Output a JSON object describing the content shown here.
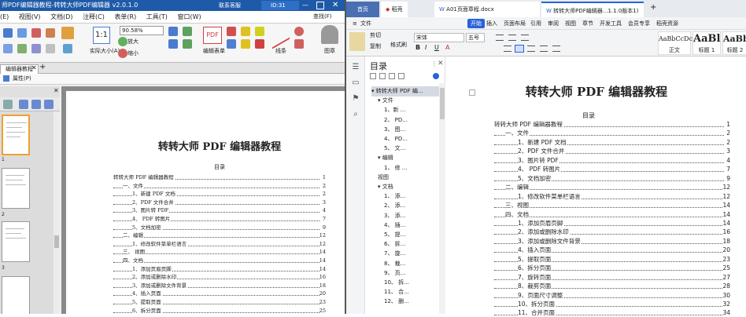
{
  "left_app": {
    "title": "师PDF编辑器教程-转转大师PDF编辑器 v2.0.1.0",
    "user": "联系客服",
    "id_badge": "ID:31",
    "menu": [
      "(E)",
      "视图(V)",
      "文档(D)",
      "注释(C)",
      "表单(R)",
      "工具(T)",
      "窗口(W)"
    ],
    "search": "查找(F)",
    "zoom": "90.58%",
    "ribbon": {
      "actual_size": "实际大小(A)",
      "zoom_in": "放大",
      "zoom_out": "缩小",
      "edit_form": "编辑表单",
      "line": "线条",
      "image": "图章"
    },
    "doc_tab": "编辑器教程",
    "sub_attr": "属性(P)",
    "page_labels": [
      "1",
      "2",
      "3"
    ],
    "doc_title": "转转大师 PDF 编辑器教程",
    "toc_title": "目录",
    "toc": [
      {
        "t": "转转大师 PDF 编辑器教程",
        "p": "1"
      },
      {
        "t": "一、文件",
        "p": "2"
      },
      {
        "t": "1、新建 PDF 文档",
        "p": "2"
      },
      {
        "t": "2、PDF 文件合并",
        "p": "3"
      },
      {
        "t": "3、图片转 PDF",
        "p": "4"
      },
      {
        "t": "4、 PDF 转图片",
        "p": "7"
      },
      {
        "t": "5、文档加密",
        "p": "9"
      },
      {
        "t": "二、编辑",
        "p": "12"
      },
      {
        "t": "1、修改软件菜单栏语言",
        "p": "12"
      },
      {
        "t": "三、 视图",
        "p": "14"
      },
      {
        "t": "四、文档",
        "p": "14"
      },
      {
        "t": "1、添加页眉页脚",
        "p": "14"
      },
      {
        "t": "2、添加或删除水印",
        "p": "16"
      },
      {
        "t": "3、添加或删除文件背景",
        "p": "18"
      },
      {
        "t": "4、插入页面",
        "p": "20"
      },
      {
        "t": "5、提取页面",
        "p": "23"
      },
      {
        "t": "6、拆分页面",
        "p": "25"
      },
      {
        "t": "7、旋转页面",
        "p": "27"
      }
    ]
  },
  "right_app": {
    "tabs": [
      "首页",
      "稻壳",
      "A01页面章程.docx",
      "转转大师PDF编辑器...1.1.0版本1)"
    ],
    "menu": {
      "file": "文件",
      "start": "开始",
      "insert": "插入",
      "layout": "页面布局",
      "ref": "引用",
      "review": "审阅",
      "view": "视图",
      "section": "章节",
      "dev": "开发工具",
      "member": "会员专享",
      "res": "稻壳资源"
    },
    "font": "宋体",
    "size": "五号",
    "clipboard": {
      "cut": "剪切",
      "copy": "复制",
      "painter": "格式刷"
    },
    "styles": [
      {
        "sample": "AaBbCcDc",
        "label": "正文"
      },
      {
        "sample": "AaBl",
        "label": "标题 1"
      },
      {
        "sample": "AaBb",
        "label": "标题 2"
      }
    ],
    "nav_title": "目录",
    "nav": [
      "转转大师 PDF 编...",
      "文件",
      "1、新 ...",
      "2、 PD...",
      "3、 图...",
      "4、 PD...",
      "5、 文...",
      "编辑",
      "1、 修 ...",
      "视图",
      "文档",
      "1、 添...",
      "2、 添...",
      "3、 添...",
      "4、 插...",
      "5、 提...",
      "6、 拆...",
      "7、 旋...",
      "8、 裁...",
      "9、 页...",
      "10、 拆...",
      "11、 合...",
      "12、 删..."
    ],
    "doc_title": "转转大师 PDF 编辑器教程",
    "toc_title": "目录",
    "toc": [
      {
        "t": "转转大师 PDF 编辑器教程",
        "p": "1"
      },
      {
        "t": "一、文件",
        "p": "2"
      },
      {
        "t": "1、新建 PDF 文档",
        "p": "2"
      },
      {
        "t": "2、PDF 文件合并",
        "p": "3"
      },
      {
        "t": "3、图片转 PDF",
        "p": "4"
      },
      {
        "t": "4、 PDF 转图片",
        "p": "7"
      },
      {
        "t": "5、文档加密",
        "p": "9"
      },
      {
        "t": "二、编辑",
        "p": "12"
      },
      {
        "t": "1、修改软件菜单栏语言",
        "p": "12"
      },
      {
        "t": "三、视图",
        "p": "14"
      },
      {
        "t": "四、文档",
        "p": "14"
      },
      {
        "t": "1、添加页眉页脚",
        "p": "14"
      },
      {
        "t": "2、添加或删除水印",
        "p": "16"
      },
      {
        "t": "3、添加或删除文件背景",
        "p": "18"
      },
      {
        "t": "4、插入页面",
        "p": "20"
      },
      {
        "t": "5、提取页面",
        "p": "23"
      },
      {
        "t": "6、拆分页面",
        "p": "25"
      },
      {
        "t": "7、旋转页面",
        "p": "27"
      },
      {
        "t": "8、裁剪页面",
        "p": "28"
      },
      {
        "t": "9、页面尺寸调整",
        "p": "30"
      },
      {
        "t": "10、拆分页面",
        "p": "32"
      },
      {
        "t": "11、合并页面",
        "p": "34"
      }
    ]
  }
}
